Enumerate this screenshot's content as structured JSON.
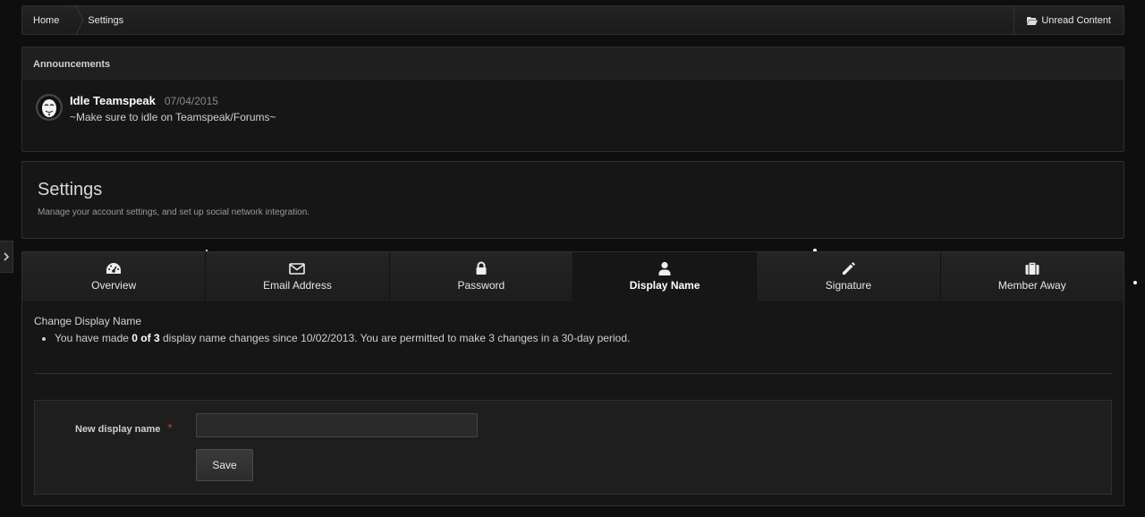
{
  "breadcrumb": {
    "items": [
      "Home",
      "Settings"
    ],
    "unread_label": "Unread Content"
  },
  "announcements": {
    "heading": "Announcements",
    "items": [
      {
        "title": "Idle Teamspeak",
        "date": "07/04/2015",
        "text": "~Make sure to idle on Teamspeak/Forums~"
      }
    ]
  },
  "settings": {
    "title": "Settings",
    "subtitle": "Manage your account settings, and set up social network integration."
  },
  "tabs": [
    {
      "label": "Overview",
      "icon": "dashboard-icon"
    },
    {
      "label": "Email Address",
      "icon": "envelope-icon"
    },
    {
      "label": "Password",
      "icon": "lock-icon"
    },
    {
      "label": "Display Name",
      "icon": "user-icon",
      "active": true
    },
    {
      "label": "Signature",
      "icon": "pencil-icon"
    },
    {
      "label": "Member Away",
      "icon": "briefcase-icon"
    }
  ],
  "display_name": {
    "heading": "Change Display Name",
    "notice_pre": "You have made ",
    "notice_count": "0 of 3",
    "notice_post": " display name changes since 10/02/2013. You are permitted to make 3 changes in a 30-day period.",
    "field_label": "New display name",
    "field_value": "",
    "required_mark": "*",
    "save_label": "Save"
  },
  "colors": {
    "background": "#0e0e0e",
    "panel": "#161616",
    "required": "#c0392b"
  }
}
